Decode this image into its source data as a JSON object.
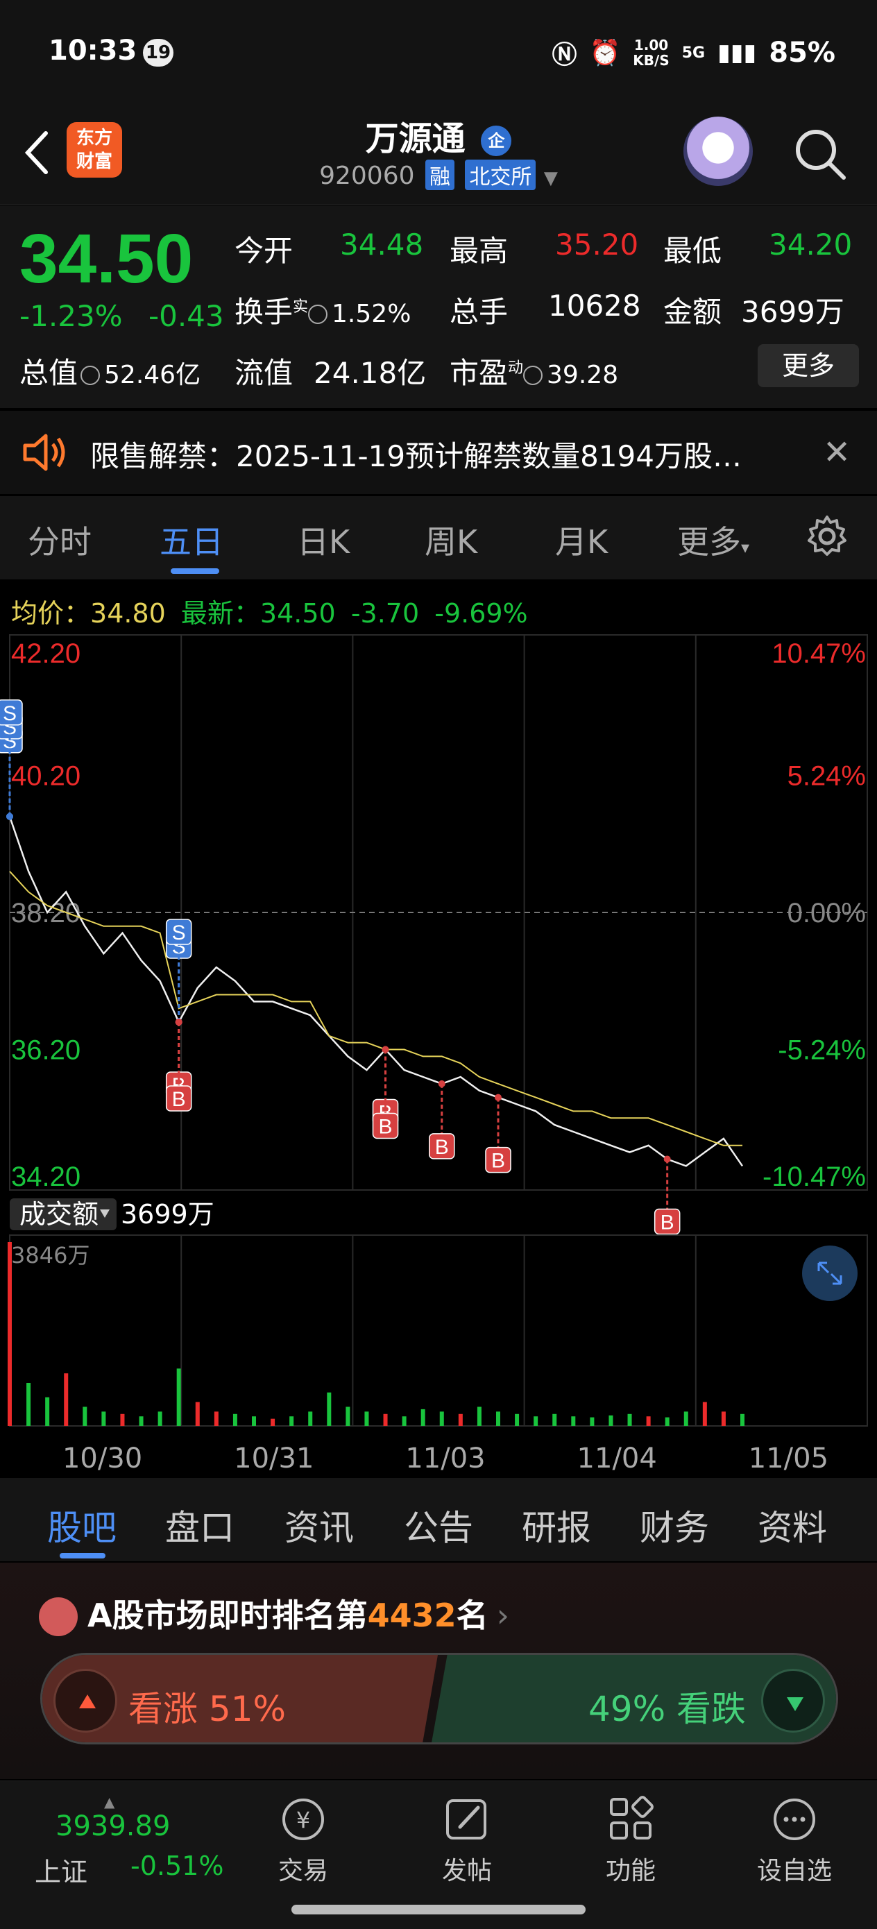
{
  "status_bar": {
    "time": "10:33",
    "badge": "19",
    "net_speed_top": "1.00",
    "net_speed_unit": "KB/S",
    "network": "5G",
    "battery": "85%"
  },
  "header": {
    "logo_line1": "东方",
    "logo_line2": "财富",
    "title": "万源通",
    "enterprise_badge": "企",
    "code": "920060",
    "tag_margin": "融",
    "tag_exchange": "北交所"
  },
  "quote": {
    "price": "34.50",
    "change_pct": "-1.23%",
    "change_abs": "-0.43",
    "open_label": "今开",
    "open_value": "34.48",
    "high_label": "最高",
    "high_value": "35.20",
    "low_label": "最低",
    "low_value": "34.20",
    "turnover_label": "换手",
    "turnover_sup": "实",
    "turnover_value": "1.52%",
    "volume_label": "总手",
    "volume_value": "10628",
    "amount_label": "金额",
    "amount_value": "3699万",
    "mktcap_label": "总值",
    "mktcap_value": "52.46亿",
    "float_label": "流值",
    "float_value": "24.18亿",
    "pe_label": "市盈",
    "pe_sup": "动",
    "pe_value": "39.28",
    "more_button": "更多"
  },
  "notice": {
    "text": "限售解禁：2025-11-19预计解禁数量8194万股…"
  },
  "tabs": {
    "items": [
      "分时",
      "五日",
      "日K",
      "周K",
      "月K",
      "更多"
    ],
    "active_index": 1
  },
  "chart_header": {
    "avg_label": "均价：",
    "avg_value": "34.80",
    "latest_label": "最新：",
    "latest_value": "34.50",
    "latest_change": "-3.70",
    "latest_pct": "-9.69%"
  },
  "chart_data": {
    "type": "line",
    "y_ticks_left": [
      "42.20",
      "40.20",
      "38.20",
      "36.20",
      "34.20"
    ],
    "y_ticks_right": [
      "10.47%",
      "5.24%",
      "0.00%",
      "-5.24%",
      "-10.47%"
    ],
    "ylim": [
      34.2,
      42.2
    ],
    "x_labels": [
      "10/30",
      "10/31",
      "11/03",
      "11/04",
      "11/05"
    ],
    "series": [
      {
        "values": [
          39.6,
          38.8,
          38.2,
          38.5,
          38.0,
          37.6,
          37.9,
          37.5,
          37.2,
          36.6,
          37.1,
          37.4,
          37.2,
          36.9,
          36.9,
          36.8,
          36.7,
          36.4,
          36.1,
          35.9,
          36.2,
          35.9,
          35.8,
          35.7,
          35.8,
          35.6,
          35.5,
          35.4,
          35.3,
          35.1,
          35.0,
          34.9,
          34.8,
          34.7,
          34.8,
          34.6,
          34.5,
          34.7,
          34.9,
          34.5
        ]
      },
      {
        "values": [
          38.8,
          38.5,
          38.3,
          38.2,
          38.1,
          38.0,
          38.0,
          38.0,
          37.9,
          36.8,
          36.9,
          37.0,
          37.0,
          37.0,
          37.0,
          36.9,
          36.9,
          36.4,
          36.3,
          36.3,
          36.2,
          36.2,
          36.1,
          36.1,
          36.0,
          35.8,
          35.7,
          35.6,
          35.5,
          35.4,
          35.3,
          35.3,
          35.2,
          35.2,
          35.2,
          35.1,
          35.0,
          34.9,
          34.8,
          34.8
        ]
      }
    ],
    "marks": [
      {
        "label": "S",
        "x_index": 0
      },
      {
        "label": "S",
        "x_index": 0
      },
      {
        "label": "S",
        "x_index": 0
      },
      {
        "label": "S",
        "x_index": 9
      },
      {
        "label": "S",
        "x_index": 9
      },
      {
        "label": "B",
        "x_index": 9
      },
      {
        "label": "B",
        "x_index": 9
      },
      {
        "label": "B",
        "x_index": 20
      },
      {
        "label": "B",
        "x_index": 20
      },
      {
        "label": "B",
        "x_index": 23
      },
      {
        "label": "B",
        "x_index": 26
      },
      {
        "label": "B",
        "x_index": 35
      }
    ],
    "volume_label": "成交额",
    "volume_value": "3699万",
    "volume_max": "3846万",
    "volume": [
      3846,
      900,
      600,
      1100,
      400,
      300,
      250,
      200,
      300,
      1200,
      500,
      300,
      250,
      200,
      150,
      200,
      300,
      700,
      400,
      300,
      250,
      200,
      350,
      300,
      250,
      400,
      300,
      250,
      200,
      250,
      200,
      180,
      220,
      250,
      200,
      180,
      300,
      500,
      300,
      250
    ]
  },
  "section_tabs": {
    "items": [
      "股吧",
      "盘口",
      "资讯",
      "公告",
      "研报",
      "财务",
      "资料"
    ],
    "active_index": 0
  },
  "rank": {
    "prefix": "A股市场即时排名第",
    "number": "4432",
    "suffix": "名",
    "up_text": "看涨 51%",
    "down_text": "49% 看跌"
  },
  "footer": {
    "index_value": "3939.89",
    "index_name": "上证",
    "index_pct": "-0.51%",
    "buttons": [
      "交易",
      "发帖",
      "功能",
      "设自选"
    ]
  },
  "colors": {
    "up": "#ec2b2b",
    "down": "#19c43d",
    "accent": "#4e8ff5",
    "avg_line": "#e6d35a"
  }
}
